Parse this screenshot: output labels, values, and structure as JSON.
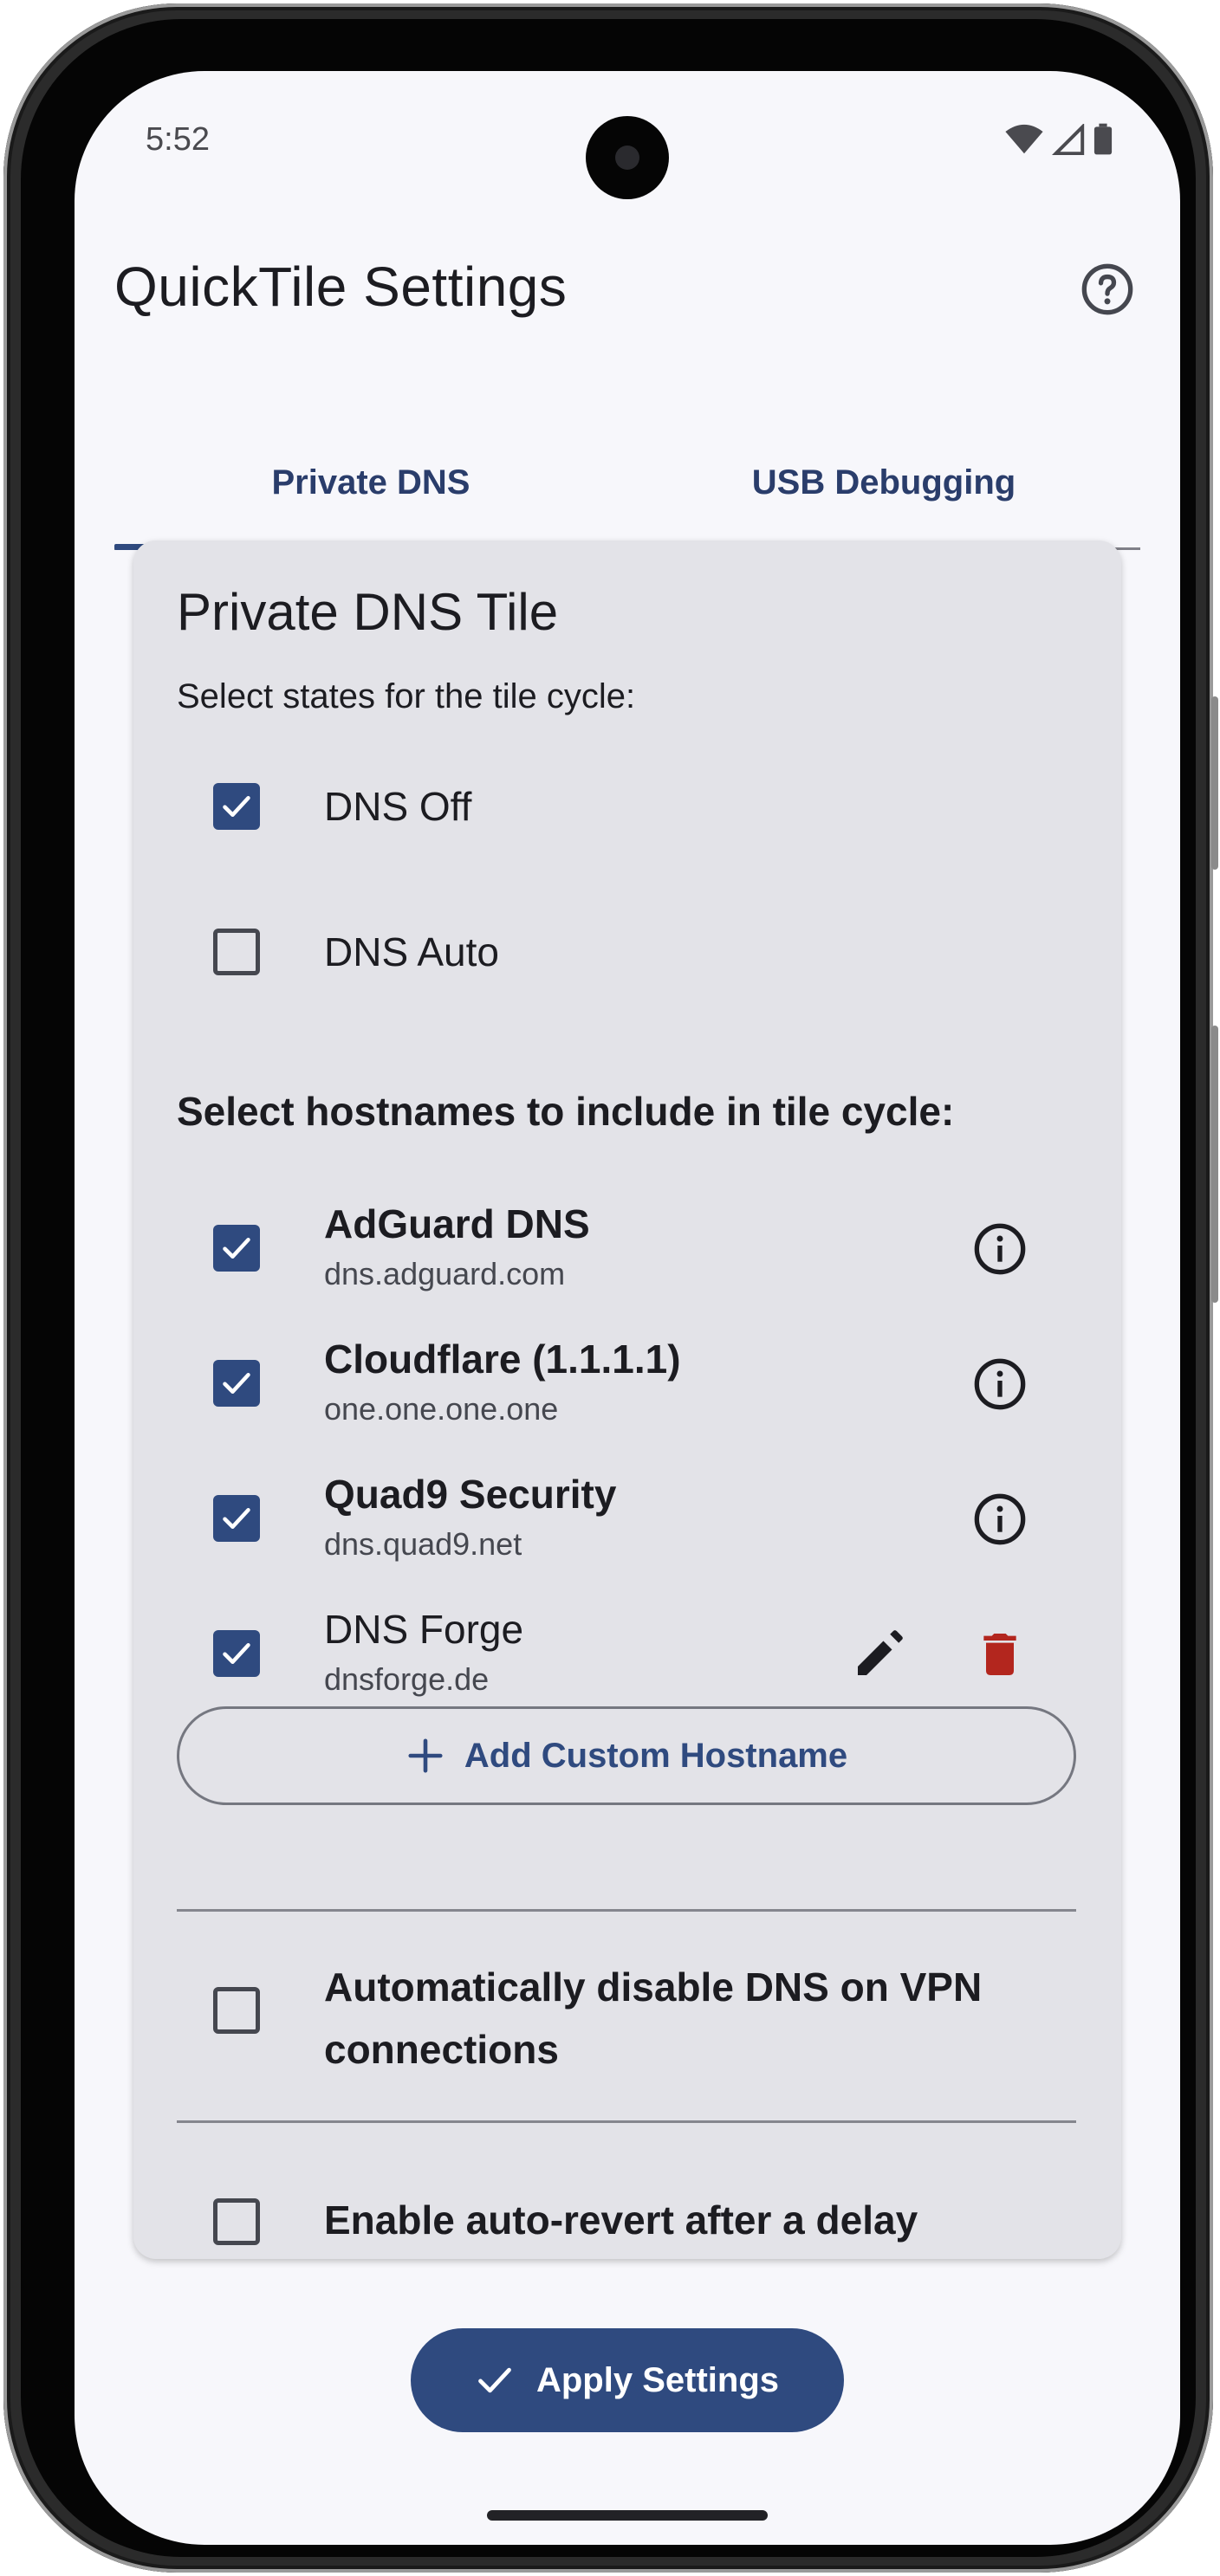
{
  "status_bar": {
    "time": "5:52"
  },
  "app_bar": {
    "title": "QuickTile Settings"
  },
  "tabs": [
    {
      "label": "Private DNS",
      "selected": true
    },
    {
      "label": "USB Debugging",
      "selected": false
    }
  ],
  "card": {
    "title": "Private DNS Tile",
    "states_prompt": "Select states for the tile cycle:",
    "states": [
      {
        "label": "DNS Off",
        "checked": true
      },
      {
        "label": "DNS Auto",
        "checked": false
      }
    ],
    "hostnames_prompt": "Select hostnames to include in tile cycle:",
    "hostnames": [
      {
        "name": "AdGuard DNS",
        "host": "dns.adguard.com",
        "checked": true,
        "action_icon": "info-icon"
      },
      {
        "name": "Cloudflare (1.1.1.1)",
        "host": "one.one.one.one",
        "checked": true,
        "action_icon": "info-icon"
      },
      {
        "name": "Quad9 Security",
        "host": "dns.quad9.net",
        "checked": true,
        "action_icon": "info-icon"
      },
      {
        "name": "DNS Forge",
        "host": "dnsforge.de",
        "checked": true,
        "action_icon": "edit-icon, delete-icon"
      }
    ],
    "add_button_label": "Add Custom Hostname",
    "vpn_option": {
      "label_line1": "Automatically disable DNS on VPN",
      "label_line2": "connections",
      "checked": false
    },
    "revert_option": {
      "label": "Enable auto-revert after a delay",
      "checked": false
    }
  },
  "apply_button_label": "Apply Settings",
  "colors": {
    "primary": "#2f4a7f",
    "card_background": "#e3e3e8",
    "screen_background": "#f7f7fb",
    "delete_red": "#b3261e",
    "text": "#1c1c21"
  }
}
